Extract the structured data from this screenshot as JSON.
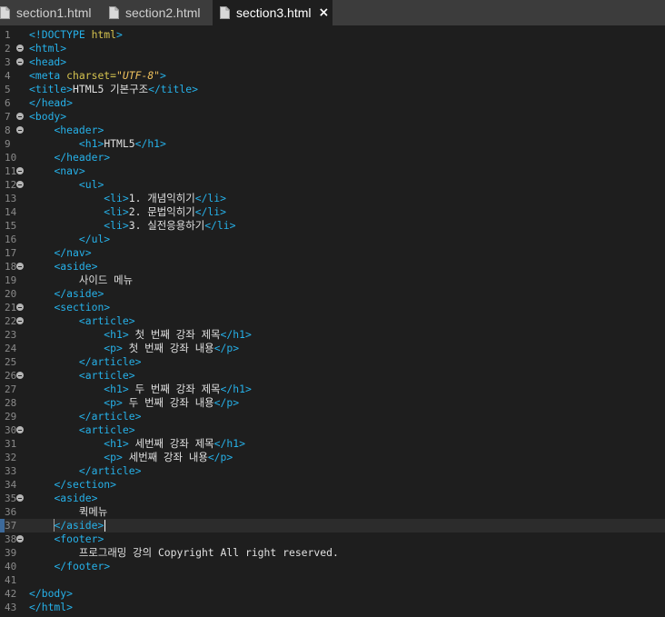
{
  "tabs": [
    {
      "label": "section1.html",
      "active": false
    },
    {
      "label": "section2.html",
      "active": false
    },
    {
      "label": "section3.html",
      "active": true
    }
  ],
  "close_icon": "×",
  "colors": {
    "tag": "#26b1e9",
    "attr": "#d4c24f",
    "string": "#f0c25e",
    "text": "#e0e0e0",
    "background": "#1e1e1e",
    "tabbar": "#3c3c3c"
  },
  "current_line": 37,
  "lines": [
    {
      "n": "1",
      "fold": false,
      "indent": "",
      "parts": [
        [
          "tg",
          "<!DOCTYPE "
        ],
        [
          "at",
          "html"
        ],
        [
          "tg",
          ">"
        ]
      ]
    },
    {
      "n": "2",
      "fold": true,
      "indent": "",
      "parts": [
        [
          "tg",
          "<html>"
        ]
      ]
    },
    {
      "n": "3",
      "fold": true,
      "indent": "",
      "parts": [
        [
          "tg",
          "<head>"
        ]
      ]
    },
    {
      "n": "4",
      "fold": false,
      "indent": "",
      "parts": [
        [
          "tg",
          "<meta "
        ],
        [
          "at",
          "charset="
        ],
        [
          "st",
          "\"UTF-8\""
        ],
        [
          "tg",
          ">"
        ]
      ]
    },
    {
      "n": "5",
      "fold": false,
      "indent": "",
      "parts": [
        [
          "tg",
          "<title>"
        ],
        [
          "tx",
          "HTML5 기본구조"
        ],
        [
          "tg",
          "</title>"
        ]
      ]
    },
    {
      "n": "6",
      "fold": false,
      "indent": "",
      "parts": [
        [
          "tg",
          "</head>"
        ]
      ]
    },
    {
      "n": "7",
      "fold": true,
      "indent": "",
      "parts": [
        [
          "tg",
          "<body>"
        ]
      ]
    },
    {
      "n": "8",
      "fold": true,
      "indent": "    ",
      "parts": [
        [
          "tg",
          "<header>"
        ]
      ]
    },
    {
      "n": "9",
      "fold": false,
      "indent": "        ",
      "parts": [
        [
          "tg",
          "<h1>"
        ],
        [
          "tx",
          "HTML5"
        ],
        [
          "tg",
          "</h1>"
        ]
      ]
    },
    {
      "n": "10",
      "fold": false,
      "indent": "    ",
      "parts": [
        [
          "tg",
          "</header>"
        ]
      ]
    },
    {
      "n": "11",
      "fold": true,
      "indent": "    ",
      "parts": [
        [
          "tg",
          "<nav>"
        ]
      ]
    },
    {
      "n": "12",
      "fold": true,
      "indent": "        ",
      "parts": [
        [
          "tg",
          "<ul>"
        ]
      ]
    },
    {
      "n": "13",
      "fold": false,
      "indent": "            ",
      "parts": [
        [
          "tg",
          "<li>"
        ],
        [
          "tx",
          "1. 개념익히기"
        ],
        [
          "tg",
          "</li>"
        ]
      ]
    },
    {
      "n": "14",
      "fold": false,
      "indent": "            ",
      "parts": [
        [
          "tg",
          "<li>"
        ],
        [
          "tx",
          "2. 문법익히기"
        ],
        [
          "tg",
          "</li>"
        ]
      ]
    },
    {
      "n": "15",
      "fold": false,
      "indent": "            ",
      "parts": [
        [
          "tg",
          "<li>"
        ],
        [
          "tx",
          "3. 실전응용하기"
        ],
        [
          "tg",
          "</li>"
        ]
      ]
    },
    {
      "n": "16",
      "fold": false,
      "indent": "        ",
      "parts": [
        [
          "tg",
          "</ul>"
        ]
      ]
    },
    {
      "n": "17",
      "fold": false,
      "indent": "    ",
      "parts": [
        [
          "tg",
          "</nav>"
        ]
      ]
    },
    {
      "n": "18",
      "fold": true,
      "indent": "    ",
      "parts": [
        [
          "tg",
          "<aside>"
        ]
      ]
    },
    {
      "n": "19",
      "fold": false,
      "indent": "        ",
      "parts": [
        [
          "tx",
          "사이드 메뉴"
        ]
      ]
    },
    {
      "n": "20",
      "fold": false,
      "indent": "    ",
      "parts": [
        [
          "tg",
          "</aside>"
        ]
      ]
    },
    {
      "n": "21",
      "fold": true,
      "indent": "    ",
      "parts": [
        [
          "tg",
          "<section>"
        ]
      ]
    },
    {
      "n": "22",
      "fold": true,
      "indent": "        ",
      "parts": [
        [
          "tg",
          "<article>"
        ]
      ]
    },
    {
      "n": "23",
      "fold": false,
      "indent": "            ",
      "parts": [
        [
          "tg",
          "<h1>"
        ],
        [
          "tx",
          " 첫 번째 강좌 제목"
        ],
        [
          "tg",
          "</h1>"
        ]
      ]
    },
    {
      "n": "24",
      "fold": false,
      "indent": "            ",
      "parts": [
        [
          "tg",
          "<p>"
        ],
        [
          "tx",
          " 첫 번째 강좌 내용"
        ],
        [
          "tg",
          "</p>"
        ]
      ]
    },
    {
      "n": "25",
      "fold": false,
      "indent": "        ",
      "parts": [
        [
          "tg",
          "</article>"
        ]
      ]
    },
    {
      "n": "26",
      "fold": true,
      "indent": "        ",
      "parts": [
        [
          "tg",
          "<article>"
        ]
      ]
    },
    {
      "n": "27",
      "fold": false,
      "indent": "            ",
      "parts": [
        [
          "tg",
          "<h1>"
        ],
        [
          "tx",
          " 두 번째 강좌 제목"
        ],
        [
          "tg",
          "</h1>"
        ]
      ]
    },
    {
      "n": "28",
      "fold": false,
      "indent": "            ",
      "parts": [
        [
          "tg",
          "<p>"
        ],
        [
          "tx",
          " 두 번째 강좌 내용"
        ],
        [
          "tg",
          "</p>"
        ]
      ]
    },
    {
      "n": "29",
      "fold": false,
      "indent": "        ",
      "parts": [
        [
          "tg",
          "</article>"
        ]
      ]
    },
    {
      "n": "30",
      "fold": true,
      "indent": "        ",
      "parts": [
        [
          "tg",
          "<article>"
        ]
      ]
    },
    {
      "n": "31",
      "fold": false,
      "indent": "            ",
      "parts": [
        [
          "tg",
          "<h1>"
        ],
        [
          "tx",
          " 세번째 강좌 제목"
        ],
        [
          "tg",
          "</h1>"
        ]
      ]
    },
    {
      "n": "32",
      "fold": false,
      "indent": "            ",
      "parts": [
        [
          "tg",
          "<p>"
        ],
        [
          "tx",
          " 세번째 강좌 내용"
        ],
        [
          "tg",
          "</p>"
        ]
      ]
    },
    {
      "n": "33",
      "fold": false,
      "indent": "        ",
      "parts": [
        [
          "tg",
          "</article>"
        ]
      ]
    },
    {
      "n": "34",
      "fold": false,
      "indent": "    ",
      "parts": [
        [
          "tg",
          "</section>"
        ]
      ]
    },
    {
      "n": "35",
      "fold": true,
      "indent": "    ",
      "parts": [
        [
          "tg",
          "<aside>"
        ]
      ]
    },
    {
      "n": "36",
      "fold": false,
      "indent": "        ",
      "parts": [
        [
          "tx",
          "퀵메뉴"
        ]
      ]
    },
    {
      "n": "37",
      "fold": false,
      "indent": "    ",
      "parts": [
        [
          "tg",
          "</aside>"
        ]
      ]
    },
    {
      "n": "38",
      "fold": true,
      "indent": "    ",
      "parts": [
        [
          "tg",
          "<footer>"
        ]
      ]
    },
    {
      "n": "39",
      "fold": false,
      "indent": "        ",
      "parts": [
        [
          "tx",
          "프로그래밍 강의 Copyright All right reserved."
        ]
      ]
    },
    {
      "n": "40",
      "fold": false,
      "indent": "    ",
      "parts": [
        [
          "tg",
          "</footer>"
        ]
      ]
    },
    {
      "n": "41",
      "fold": false,
      "indent": "",
      "parts": []
    },
    {
      "n": "42",
      "fold": false,
      "indent": "",
      "parts": [
        [
          "tg",
          "</body>"
        ]
      ]
    },
    {
      "n": "43",
      "fold": false,
      "indent": "",
      "parts": [
        [
          "tg",
          "</html>"
        ]
      ]
    }
  ]
}
